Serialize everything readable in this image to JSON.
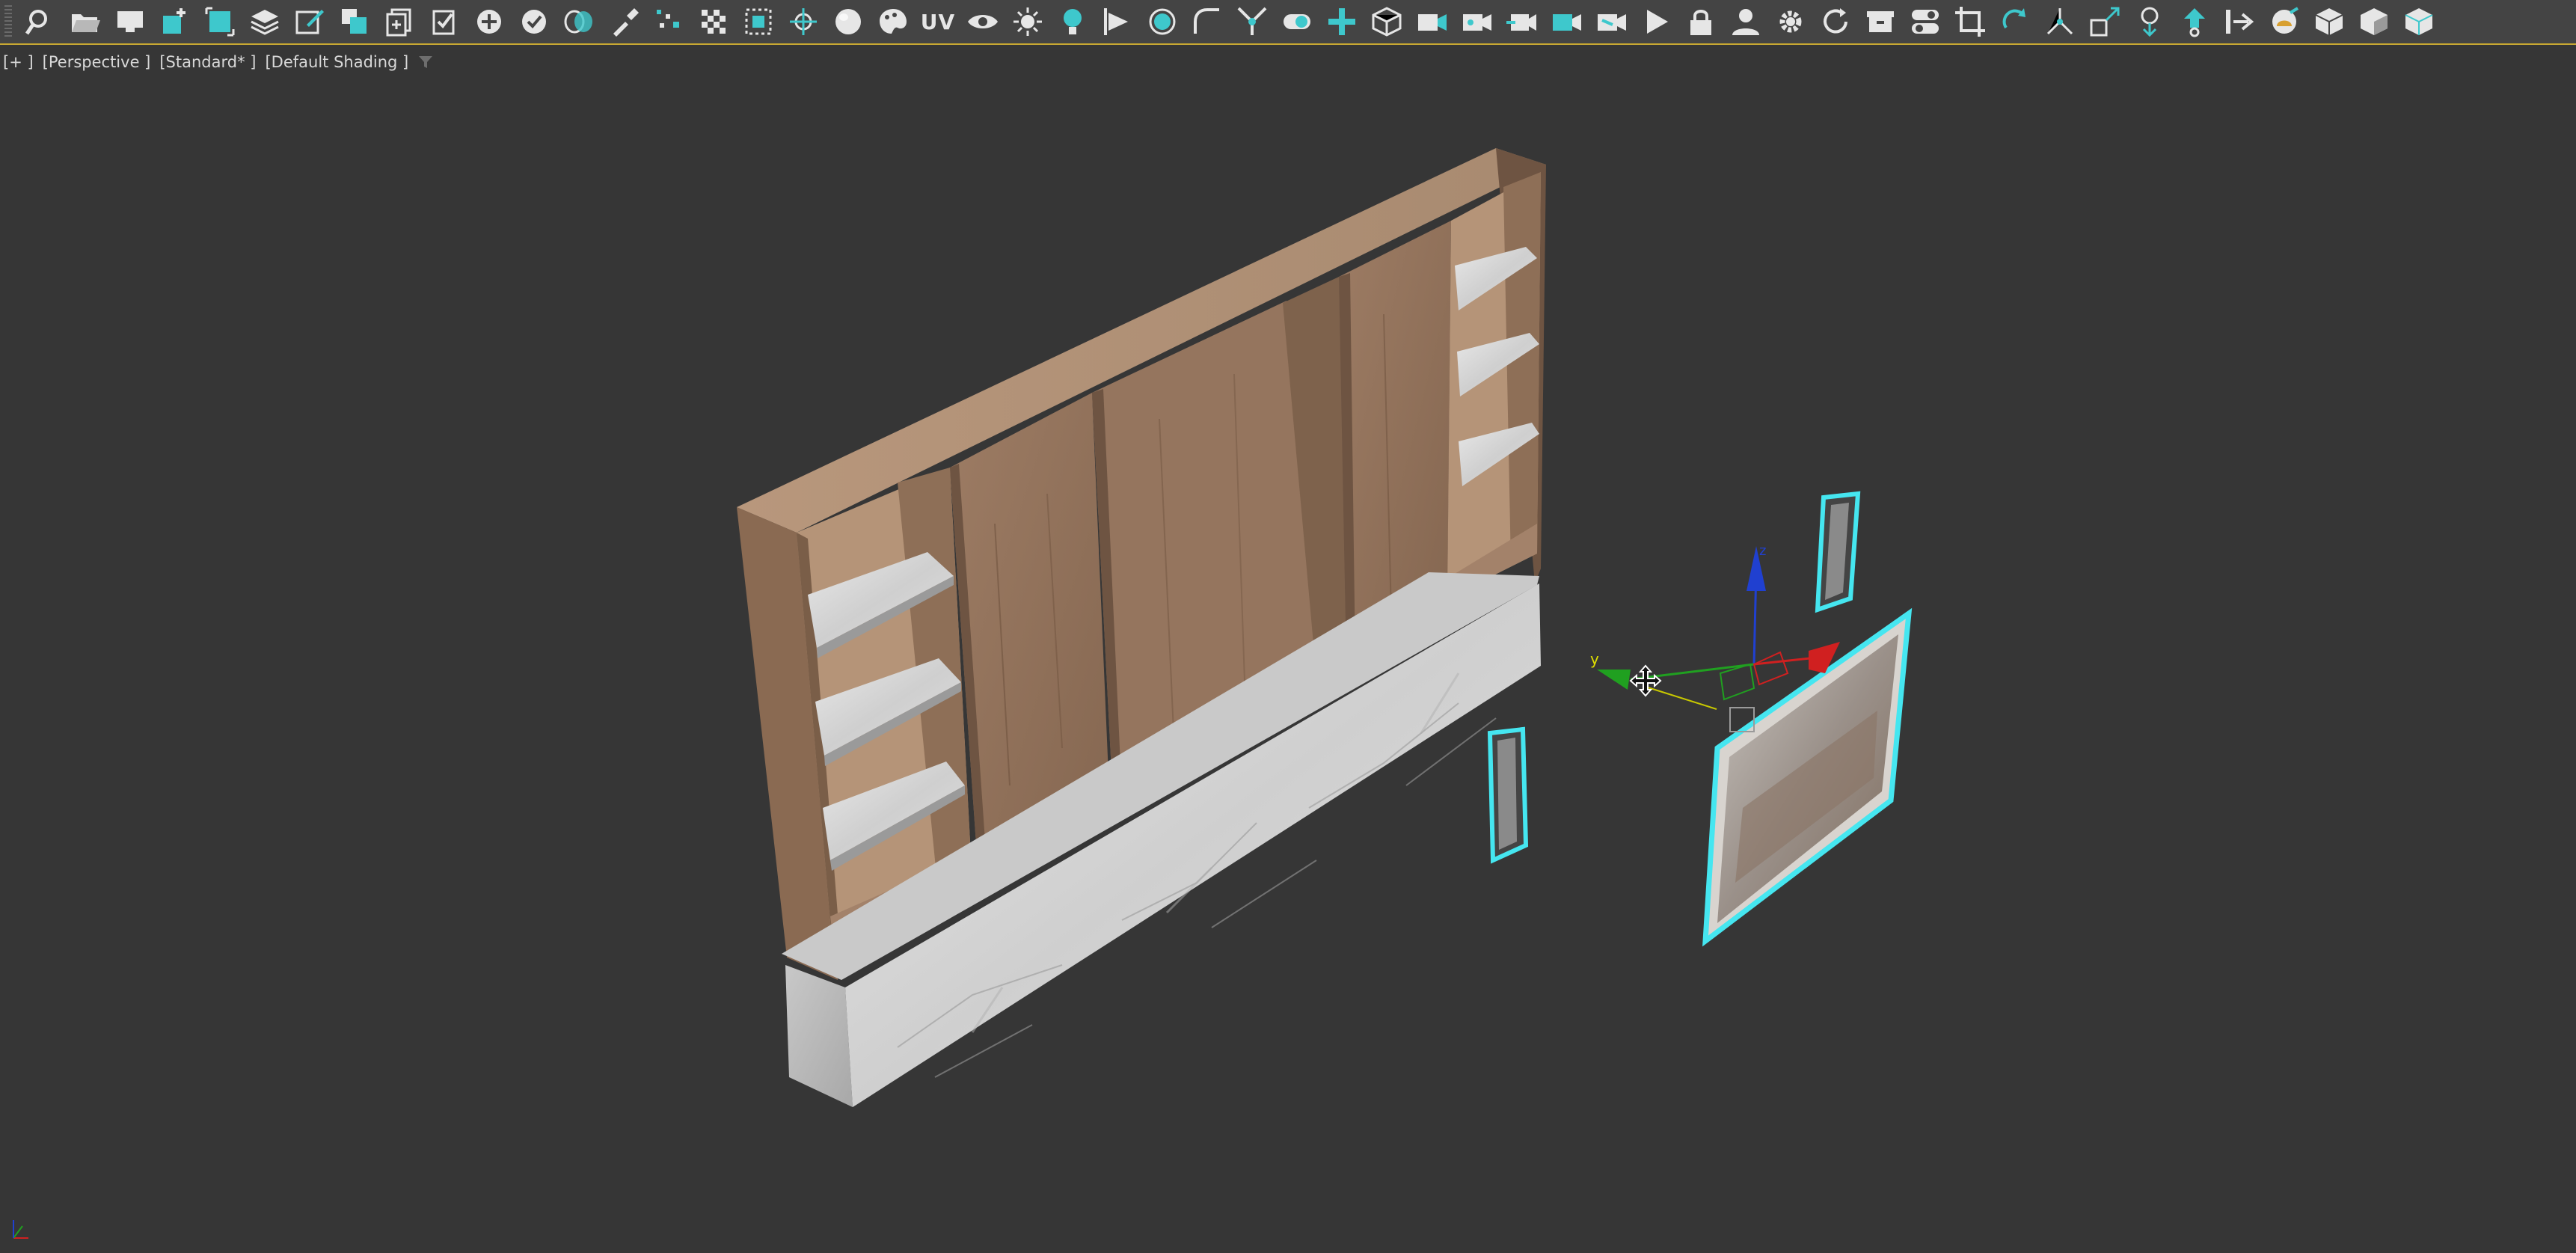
{
  "toolbar": {
    "icons": [
      "search-icon",
      "open-folder-icon",
      "monitor-icon",
      "create-object-icon",
      "select-region-icon",
      "layers-icon",
      "edit-icon",
      "clone-icon",
      "copy-icon",
      "checklist-icon",
      "add-circle-icon",
      "check-circle-icon",
      "rings-icon",
      "eyedropper-icon",
      "scatter-icon",
      "checker-icon",
      "pattern-icon",
      "snap-target-icon",
      "sphere-icon",
      "paint-palette-icon",
      "uv-icon",
      "eye-icon",
      "sun-icon",
      "light-bulb-icon",
      "align-icon",
      "target-circle-icon",
      "fillet-icon",
      "blade-icon",
      "toggle-icon",
      "add-plus-icon",
      "box-3d-icon",
      "camera-icon",
      "camera-record-icon",
      "camera-import-icon",
      "camera-box-icon",
      "camera-swap-icon",
      "play-icon",
      "lock-icon",
      "user-icon",
      "gear-icon",
      "refresh-icon",
      "archive-icon",
      "switch-icon",
      "crop-icon",
      "redo-rotate-icon",
      "spin-icon",
      "scale-icon",
      "drop-down-icon",
      "push-up-icon",
      "export-icon",
      "render-teapot-icon",
      "cube-icon",
      "cube-side-icon",
      "cube-stack-icon"
    ],
    "uv_label": "UV"
  },
  "viewport": {
    "label_plus": "[+ ]",
    "label_view": "[Perspective ]",
    "label_renderer": "[Standard* ]",
    "label_shading": "[Default Shading ]",
    "filter_icon": "funnel-icon"
  },
  "gizmo": {
    "y_label": "y",
    "z_label": "z"
  },
  "colors": {
    "viewport_bg": "#363636",
    "toolbar_bg": "#444444",
    "toolbar_accent": "#c8a832",
    "icon_teal": "#3ec8cc",
    "icon_light": "#e6e6e6",
    "wood": "#a3826a",
    "wood_dark": "#7a5e48",
    "marble": "#dcdcdc",
    "selection": "#45e6f0",
    "axis_x": "#d02020",
    "axis_y": "#20a020",
    "axis_z": "#2040d0"
  }
}
